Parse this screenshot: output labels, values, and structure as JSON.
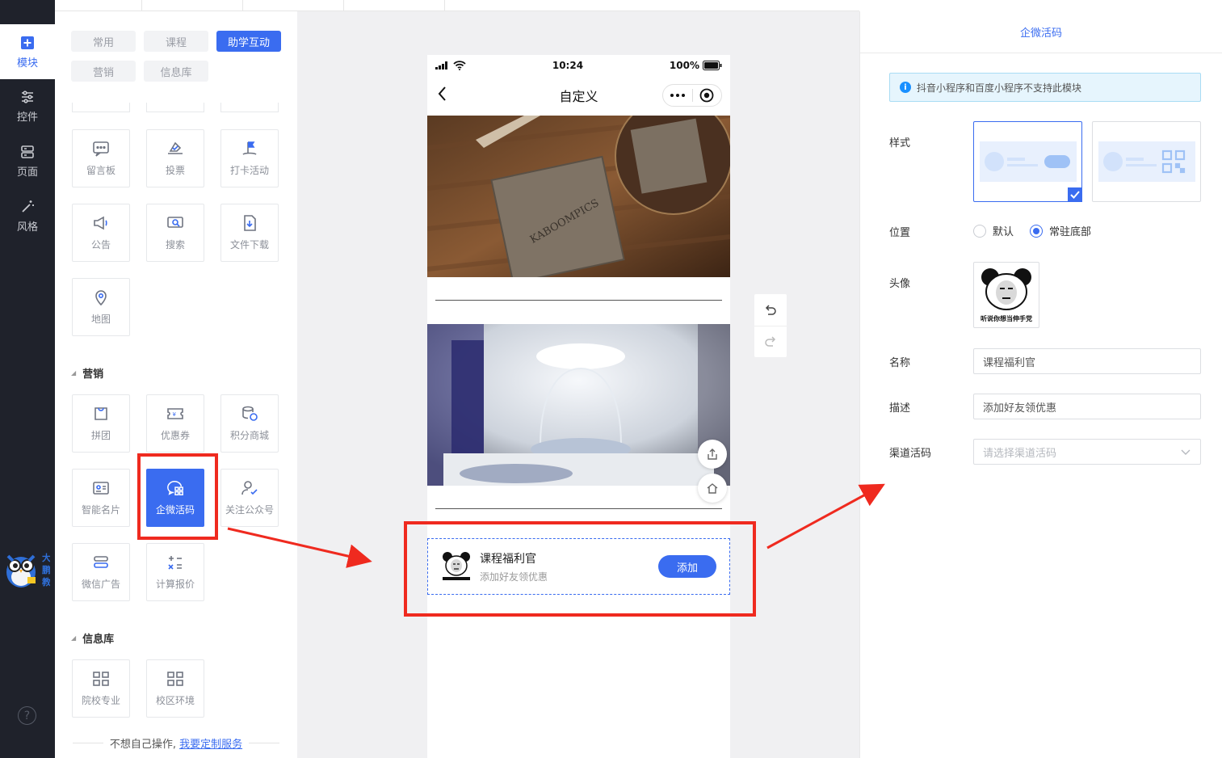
{
  "sidebar": {
    "items": [
      {
        "label": "模块",
        "icon": "plus-square-icon",
        "active": true
      },
      {
        "label": "控件",
        "icon": "sliders-icon"
      },
      {
        "label": "页面",
        "icon": "server-stack-icon"
      },
      {
        "label": "风格",
        "icon": "magic-wand-icon"
      }
    ],
    "help_glyph": "?"
  },
  "component_panel": {
    "tabs": [
      {
        "label": "常用"
      },
      {
        "label": "课程"
      },
      {
        "label": "助学互动",
        "active": true
      },
      {
        "label": "营销"
      },
      {
        "label": "信息库"
      }
    ],
    "interaction_items": [
      {
        "label": "留言板",
        "icon": "message-board-icon"
      },
      {
        "label": "投票",
        "icon": "vote-icon"
      },
      {
        "label": "打卡活动",
        "icon": "checkin-flag-icon"
      },
      {
        "label": "公告",
        "icon": "megaphone-icon"
      },
      {
        "label": "搜索",
        "icon": "search-icon"
      },
      {
        "label": "文件下载",
        "icon": "file-download-icon"
      },
      {
        "label": "地图",
        "icon": "map-pin-icon"
      }
    ],
    "marketing_section": {
      "title": "营销",
      "items": [
        {
          "label": "拼团",
          "icon": "group-buy-icon"
        },
        {
          "label": "优惠券",
          "icon": "coupon-icon"
        },
        {
          "label": "积分商城",
          "icon": "points-mall-icon"
        },
        {
          "label": "智能名片",
          "icon": "business-card-icon"
        },
        {
          "label": "企微活码",
          "icon": "wecom-qrcode-icon",
          "selected": true
        },
        {
          "label": "关注公众号",
          "icon": "follow-account-icon"
        },
        {
          "label": "微信广告",
          "icon": "wechat-ad-icon"
        },
        {
          "label": "计算报价",
          "icon": "calculator-icon"
        }
      ]
    },
    "info_section": {
      "title": "信息库",
      "items": [
        {
          "label": "院校专业",
          "icon": "grid-list-icon"
        },
        {
          "label": "校区环境",
          "icon": "grid-list-icon"
        }
      ]
    },
    "footer": {
      "text": "不想自己操作,",
      "link": "我要定制服务"
    }
  },
  "phone": {
    "status": {
      "time": "10:24",
      "battery": "100%"
    },
    "title": "自定义",
    "wecom_card": {
      "name": "课程福利官",
      "desc": "添加好友领优惠",
      "button": "添加"
    }
  },
  "settings": {
    "title": "企微活码",
    "notice": "抖音小程序和百度小程序不支持此模块",
    "style_label": "样式",
    "position": {
      "label": "位置",
      "options": [
        {
          "label": "默认"
        },
        {
          "label": "常驻底部",
          "selected": true
        }
      ]
    },
    "avatar_label": "头像",
    "avatar_caption": "听说你想当伸手党",
    "name": {
      "label": "名称",
      "value": "课程福利官"
    },
    "desc": {
      "label": "描述",
      "value": "添加好友领优惠"
    },
    "channel": {
      "label": "渠道活码",
      "placeholder": "请选择渠道活码"
    }
  },
  "colors": {
    "primary": "#3a6cf0",
    "sidebar_bg": "#1f222b",
    "annotation_red": "#ef2a1f",
    "notice_bg": "#e6f5fd"
  }
}
